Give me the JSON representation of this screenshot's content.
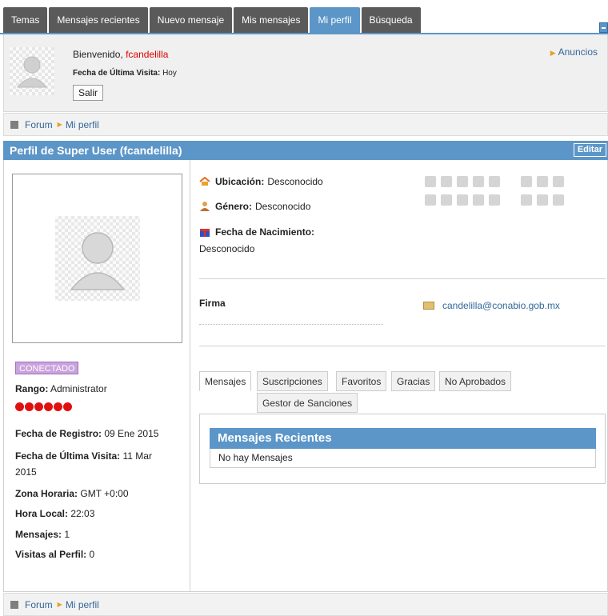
{
  "nav": {
    "tabs": [
      {
        "label": "Temas"
      },
      {
        "label": "Mensajes recientes"
      },
      {
        "label": "Nuevo mensaje"
      },
      {
        "label": "Mis mensajes"
      },
      {
        "label": "Mi perfil",
        "active": true
      },
      {
        "label": "Búsqueda"
      }
    ]
  },
  "welcome": {
    "greeting": "Bienvenido,",
    "username": "fcandelilla",
    "last_visit_label": "Fecha de Última Visita:",
    "last_visit_value": "Hoy",
    "logout_label": "Salir",
    "ads_label": "Anuncios"
  },
  "breadcrumb": {
    "root": "Forum",
    "current": "Mi perfil"
  },
  "profile": {
    "title": "Perfil de Super User (fcandelilla)",
    "edit_label": "Editar",
    "online_badge": "CONECTADO",
    "rank_label": "Rango:",
    "rank_value": "Administrator",
    "registered_label": "Fecha de Registro:",
    "registered_value": "09 Ene 2015",
    "last_visit_label": "Fecha de Última Visita:",
    "last_visit_value_1": "11 Mar",
    "last_visit_value_2": "2015",
    "timezone_label": "Zona Horaria:",
    "timezone_value": "GMT +0:00",
    "local_time_label": "Hora Local:",
    "local_time_value": "22:03",
    "posts_label": "Mensajes:",
    "posts_value": "1",
    "views_label": "Visitas al Perfil:",
    "views_value": "0",
    "location_label": "Ubicación:",
    "location_value": "Desconocido",
    "gender_label": "Género:",
    "gender_value": "Desconocido",
    "birthday_label": "Fecha de Nacimiento:",
    "birthday_value": "Desconocido",
    "signature_label": "Firma",
    "email": "candelilla@conabio.gob.mx"
  },
  "profile_tabs": [
    {
      "label": "Mensajes",
      "active": true
    },
    {
      "label": "Suscripciones"
    },
    {
      "label": "Favoritos"
    },
    {
      "label": "Gracias"
    },
    {
      "label": "No Aprobados"
    },
    {
      "label": "Gestor de Sanciones"
    }
  ],
  "recent": {
    "header": "Mensajes Recientes",
    "empty": "No hay Mensajes"
  },
  "colors": {
    "accent": "#5c96c8",
    "tab_bg": "#5a5a5a",
    "username": "#e00000",
    "link": "#336699",
    "badge": "#c9a3dc"
  }
}
